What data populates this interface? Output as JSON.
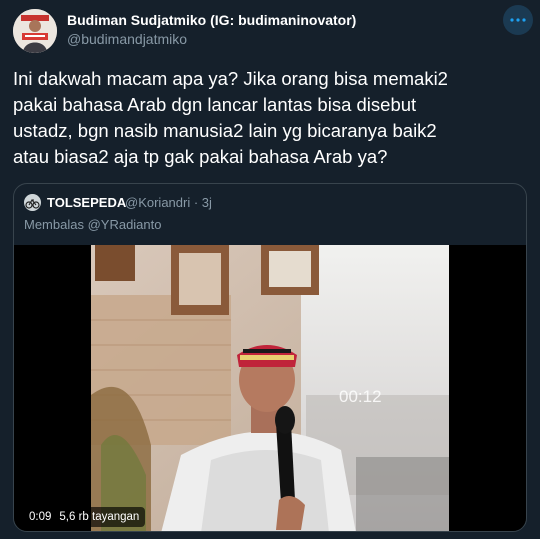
{
  "tweet": {
    "author_name": "Budiman Sudjatmiko (IG: budimaninovator)",
    "author_handle": "@budimandjatmiko",
    "text": "Ini dakwah macam apa ya? Jika orang bisa memaki2\npakai bahasa Arab dgn lancar lantas bisa disebut\nustadz, bgn nasib manusia2 lain yg bicaranya baik2\natau biasa2 aja tp gak pakai bahasa Arab ya?",
    "more_icon": "more-dots-icon"
  },
  "quoted": {
    "name": "TOLSEPEDA",
    "handle": "@Koriandri",
    "time": "· 3j",
    "reply_text": "Membalas @YRadianto",
    "video": {
      "time": "0:09",
      "views": "5,6 rb tayangan",
      "overlay_timecode": "00:12"
    }
  },
  "colors": {
    "background": "#15202b",
    "secondary_text": "#8899a6",
    "border": "#38444d",
    "accent": "#1da1f2"
  }
}
